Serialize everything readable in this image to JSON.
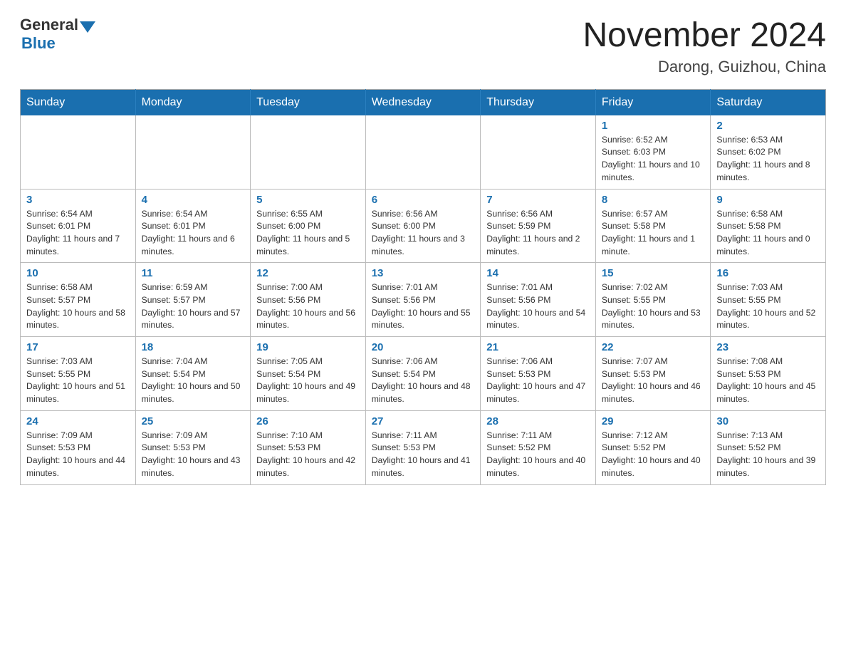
{
  "header": {
    "logo_general": "General",
    "logo_blue": "Blue",
    "month_title": "November 2024",
    "location": "Darong, Guizhou, China"
  },
  "weekdays": [
    "Sunday",
    "Monday",
    "Tuesday",
    "Wednesday",
    "Thursday",
    "Friday",
    "Saturday"
  ],
  "weeks": [
    [
      {
        "day": "",
        "info": ""
      },
      {
        "day": "",
        "info": ""
      },
      {
        "day": "",
        "info": ""
      },
      {
        "day": "",
        "info": ""
      },
      {
        "day": "",
        "info": ""
      },
      {
        "day": "1",
        "info": "Sunrise: 6:52 AM\nSunset: 6:03 PM\nDaylight: 11 hours and 10 minutes."
      },
      {
        "day": "2",
        "info": "Sunrise: 6:53 AM\nSunset: 6:02 PM\nDaylight: 11 hours and 8 minutes."
      }
    ],
    [
      {
        "day": "3",
        "info": "Sunrise: 6:54 AM\nSunset: 6:01 PM\nDaylight: 11 hours and 7 minutes."
      },
      {
        "day": "4",
        "info": "Sunrise: 6:54 AM\nSunset: 6:01 PM\nDaylight: 11 hours and 6 minutes."
      },
      {
        "day": "5",
        "info": "Sunrise: 6:55 AM\nSunset: 6:00 PM\nDaylight: 11 hours and 5 minutes."
      },
      {
        "day": "6",
        "info": "Sunrise: 6:56 AM\nSunset: 6:00 PM\nDaylight: 11 hours and 3 minutes."
      },
      {
        "day": "7",
        "info": "Sunrise: 6:56 AM\nSunset: 5:59 PM\nDaylight: 11 hours and 2 minutes."
      },
      {
        "day": "8",
        "info": "Sunrise: 6:57 AM\nSunset: 5:58 PM\nDaylight: 11 hours and 1 minute."
      },
      {
        "day": "9",
        "info": "Sunrise: 6:58 AM\nSunset: 5:58 PM\nDaylight: 11 hours and 0 minutes."
      }
    ],
    [
      {
        "day": "10",
        "info": "Sunrise: 6:58 AM\nSunset: 5:57 PM\nDaylight: 10 hours and 58 minutes."
      },
      {
        "day": "11",
        "info": "Sunrise: 6:59 AM\nSunset: 5:57 PM\nDaylight: 10 hours and 57 minutes."
      },
      {
        "day": "12",
        "info": "Sunrise: 7:00 AM\nSunset: 5:56 PM\nDaylight: 10 hours and 56 minutes."
      },
      {
        "day": "13",
        "info": "Sunrise: 7:01 AM\nSunset: 5:56 PM\nDaylight: 10 hours and 55 minutes."
      },
      {
        "day": "14",
        "info": "Sunrise: 7:01 AM\nSunset: 5:56 PM\nDaylight: 10 hours and 54 minutes."
      },
      {
        "day": "15",
        "info": "Sunrise: 7:02 AM\nSunset: 5:55 PM\nDaylight: 10 hours and 53 minutes."
      },
      {
        "day": "16",
        "info": "Sunrise: 7:03 AM\nSunset: 5:55 PM\nDaylight: 10 hours and 52 minutes."
      }
    ],
    [
      {
        "day": "17",
        "info": "Sunrise: 7:03 AM\nSunset: 5:55 PM\nDaylight: 10 hours and 51 minutes."
      },
      {
        "day": "18",
        "info": "Sunrise: 7:04 AM\nSunset: 5:54 PM\nDaylight: 10 hours and 50 minutes."
      },
      {
        "day": "19",
        "info": "Sunrise: 7:05 AM\nSunset: 5:54 PM\nDaylight: 10 hours and 49 minutes."
      },
      {
        "day": "20",
        "info": "Sunrise: 7:06 AM\nSunset: 5:54 PM\nDaylight: 10 hours and 48 minutes."
      },
      {
        "day": "21",
        "info": "Sunrise: 7:06 AM\nSunset: 5:53 PM\nDaylight: 10 hours and 47 minutes."
      },
      {
        "day": "22",
        "info": "Sunrise: 7:07 AM\nSunset: 5:53 PM\nDaylight: 10 hours and 46 minutes."
      },
      {
        "day": "23",
        "info": "Sunrise: 7:08 AM\nSunset: 5:53 PM\nDaylight: 10 hours and 45 minutes."
      }
    ],
    [
      {
        "day": "24",
        "info": "Sunrise: 7:09 AM\nSunset: 5:53 PM\nDaylight: 10 hours and 44 minutes."
      },
      {
        "day": "25",
        "info": "Sunrise: 7:09 AM\nSunset: 5:53 PM\nDaylight: 10 hours and 43 minutes."
      },
      {
        "day": "26",
        "info": "Sunrise: 7:10 AM\nSunset: 5:53 PM\nDaylight: 10 hours and 42 minutes."
      },
      {
        "day": "27",
        "info": "Sunrise: 7:11 AM\nSunset: 5:53 PM\nDaylight: 10 hours and 41 minutes."
      },
      {
        "day": "28",
        "info": "Sunrise: 7:11 AM\nSunset: 5:52 PM\nDaylight: 10 hours and 40 minutes."
      },
      {
        "day": "29",
        "info": "Sunrise: 7:12 AM\nSunset: 5:52 PM\nDaylight: 10 hours and 40 minutes."
      },
      {
        "day": "30",
        "info": "Sunrise: 7:13 AM\nSunset: 5:52 PM\nDaylight: 10 hours and 39 minutes."
      }
    ]
  ]
}
